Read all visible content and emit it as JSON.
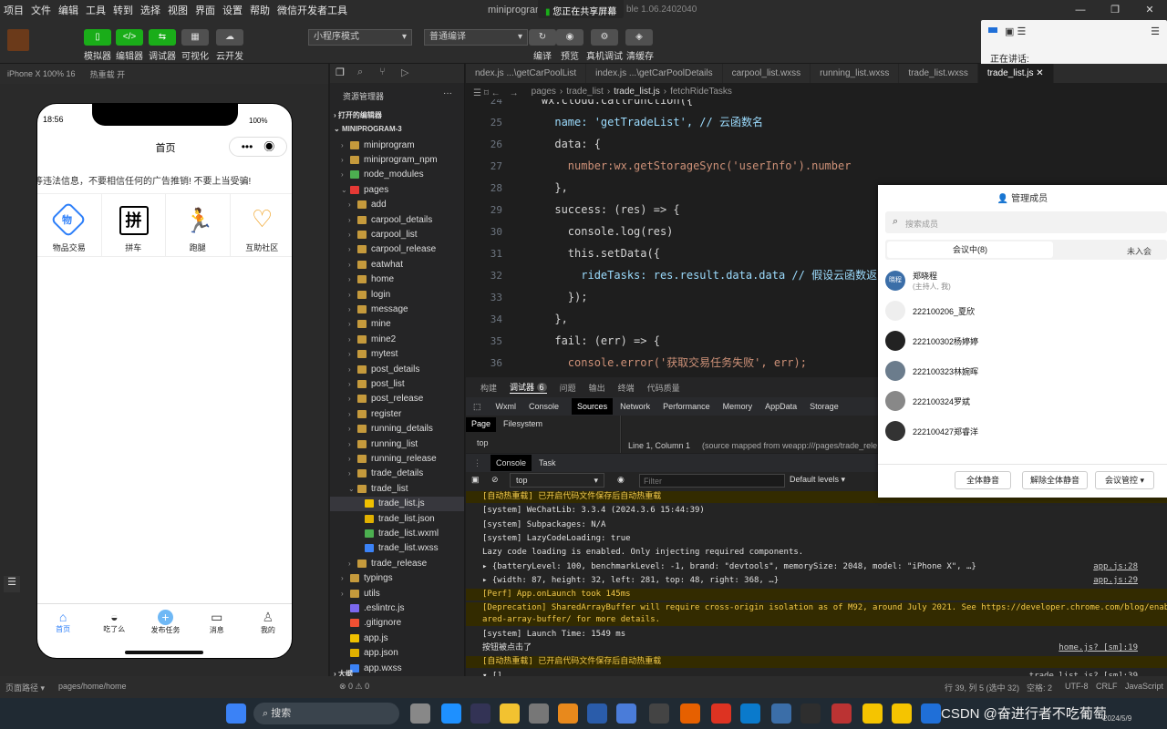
{
  "menubar": {
    "items": [
      "项目",
      "文件",
      "编辑",
      "工具",
      "转到",
      "选择",
      "视图",
      "界面",
      "设置",
      "帮助",
      "微信开发者工具"
    ],
    "title_left": "miniprogram",
    "title_right": "ble 1.06.2402040"
  },
  "share_banner": "您正在共享屏幕",
  "speaking": {
    "label": "正在讲话:"
  },
  "toolbar": {
    "buttons": [
      "模拟器",
      "编辑器",
      "调试器",
      "可视化",
      "云开发"
    ],
    "mode_select": "小程序模式",
    "compile_select": "普通编译",
    "right_buttons": [
      "编译",
      "预览",
      "真机调试",
      "清缓存"
    ]
  },
  "simulator": {
    "device": "iPhone X 100% 16",
    "hot_reload": "热重载 开",
    "status_time": "18:56",
    "battery": "100%",
    "nav_title": "首页",
    "marquee": "等违法信息，不要相信任何的广告推销! 不要上当受骗!",
    "grid": [
      "物品交易",
      "拼车",
      "跑腿",
      "互助社区"
    ],
    "grid_icon_text": [
      "物",
      "拼"
    ],
    "tabbar": [
      "首页",
      "吃了么",
      "发布任务",
      "消息",
      "我的"
    ]
  },
  "explorer": {
    "title": "资源管理器",
    "open_editors": "打开的编辑器",
    "project": "MINIPROGRAM-3",
    "items": [
      {
        "name": "miniprogram",
        "type": "folder",
        "indent": 1
      },
      {
        "name": "miniprogram_npm",
        "type": "folder",
        "indent": 1
      },
      {
        "name": "node_modules",
        "type": "folder-green",
        "indent": 1
      },
      {
        "name": "pages",
        "type": "folder-red",
        "indent": 1
      },
      {
        "name": "add",
        "type": "folder",
        "indent": 2
      },
      {
        "name": "carpool_details",
        "type": "folder",
        "indent": 2
      },
      {
        "name": "carpool_list",
        "type": "folder",
        "indent": 2
      },
      {
        "name": "carpool_release",
        "type": "folder",
        "indent": 2
      },
      {
        "name": "eatwhat",
        "type": "folder",
        "indent": 2
      },
      {
        "name": "home",
        "type": "folder",
        "indent": 2
      },
      {
        "name": "login",
        "type": "folder",
        "indent": 2
      },
      {
        "name": "message",
        "type": "folder",
        "indent": 2
      },
      {
        "name": "mine",
        "type": "folder",
        "indent": 2
      },
      {
        "name": "mine2",
        "type": "folder",
        "indent": 2
      },
      {
        "name": "mytest",
        "type": "folder",
        "indent": 2
      },
      {
        "name": "post_details",
        "type": "folder",
        "indent": 2
      },
      {
        "name": "post_list",
        "type": "folder",
        "indent": 2
      },
      {
        "name": "post_release",
        "type": "folder",
        "indent": 2
      },
      {
        "name": "register",
        "type": "folder",
        "indent": 2
      },
      {
        "name": "running_details",
        "type": "folder",
        "indent": 2
      },
      {
        "name": "running_list",
        "type": "folder",
        "indent": 2
      },
      {
        "name": "running_release",
        "type": "folder",
        "indent": 2
      },
      {
        "name": "trade_details",
        "type": "folder",
        "indent": 2
      },
      {
        "name": "trade_list",
        "type": "folder",
        "indent": 2
      },
      {
        "name": "trade_list.js",
        "type": "js",
        "indent": 3
      },
      {
        "name": "trade_list.json",
        "type": "json",
        "indent": 3
      },
      {
        "name": "trade_list.wxml",
        "type": "wxml",
        "indent": 3
      },
      {
        "name": "trade_list.wxss",
        "type": "wxss",
        "indent": 3
      },
      {
        "name": "trade_release",
        "type": "folder",
        "indent": 2
      },
      {
        "name": "typings",
        "type": "folder",
        "indent": 1
      },
      {
        "name": "utils",
        "type": "folder",
        "indent": 1
      },
      {
        "name": ".eslintrc.js",
        "type": "eslint",
        "indent": 1
      },
      {
        "name": ".gitignore",
        "type": "git",
        "indent": 1
      },
      {
        "name": "app.js",
        "type": "js",
        "indent": 1
      },
      {
        "name": "app.json",
        "type": "json",
        "indent": 1
      },
      {
        "name": "app.wxss",
        "type": "wxss",
        "indent": 1
      }
    ],
    "outline": "大纲",
    "problems": "⊗ 0 ⚠ 0"
  },
  "tabs": [
    "ndex.js ...\\getCarPoolList",
    "index.js ...\\getCarPoolDetails",
    "carpool_list.wxss",
    "running_list.wxss",
    "trade_list.wxss",
    "trade_list.js"
  ],
  "breadcrumb": [
    "pages",
    "trade_list",
    "trade_list.js",
    "fetchRideTasks"
  ],
  "code": [
    {
      "n": "24",
      "t": "    wx.cloud.callFunction({"
    },
    {
      "n": "25",
      "t": "      name: 'getTradeList', // 云函数名"
    },
    {
      "n": "26",
      "t": "      data: {"
    },
    {
      "n": "27",
      "t": "        number:wx.getStorageSync('userInfo').number"
    },
    {
      "n": "28",
      "t": "      },"
    },
    {
      "n": "29",
      "t": "      success: (res) => {"
    },
    {
      "n": "30",
      "t": "        console.log(res)"
    },
    {
      "n": "31",
      "t": "        this.setData({"
    },
    {
      "n": "32",
      "t": "          rideTasks: res.result.data.data // 假设云函数返回的任务"
    },
    {
      "n": "33",
      "t": "        });"
    },
    {
      "n": "34",
      "t": "      },"
    },
    {
      "n": "35",
      "t": "      fail: (err) => {"
    },
    {
      "n": "36",
      "t": "        console.error('获取交易任务失败', err);"
    }
  ],
  "panel_tabs": [
    "构建",
    "调试器",
    "问题",
    "输出",
    "终端",
    "代码质量"
  ],
  "debugger_badge": "6",
  "devtools_tabs": [
    "Wxml",
    "Console",
    "Sources",
    "Network",
    "Performance",
    "Memory",
    "AppData",
    "Storage"
  ],
  "sources": {
    "tabs": [
      "Page",
      "Filesystem"
    ],
    "tree_top": "top",
    "position": "Line 1, Column 1",
    "mapped": "(source mapped from weapp:///pages/trade_rele"
  },
  "console": {
    "tabs": [
      "Console",
      "Task"
    ],
    "context": "top",
    "filter_placeholder": "Filter",
    "levels": "Default levels",
    "lines": [
      {
        "t": "[自动热重载] 已开启代码文件保存后自动热重载",
        "w": true,
        "s": ""
      },
      {
        "t": "[system] WeChatLib: 3.3.4 (2024.3.6 15:44:39)",
        "w": false,
        "s": ""
      },
      {
        "t": "[system] Subpackages: N/A",
        "w": false,
        "s": ""
      },
      {
        "t": "[system] LazyCodeLoading: true",
        "w": false,
        "s": ""
      },
      {
        "t": "Lazy code loading is enabled. Only injecting required components.",
        "w": false,
        "s": ""
      },
      {
        "t": "▸ {batteryLevel: 100, benchmarkLevel: -1, brand: \"devtools\", memorySize: 2048, model: \"iPhone X\", …}",
        "w": false,
        "s": "app.js:28"
      },
      {
        "t": "▸ {width: 87, height: 32, left: 281, top: 48, right: 368, …}",
        "w": false,
        "s": "app.js:29"
      },
      {
        "t": "[Perf] App.onLaunch took 145ms",
        "w": true,
        "s": ""
      },
      {
        "t": "[Deprecation] SharedArrayBuffer will require cross-origin isolation as of M92, around July 2021. See https://developer.chrome.com/blog/enabling-sh\nared-array-buffer/ for more details.",
        "w": true,
        "s": ""
      },
      {
        "t": "[system] Launch Time: 1549 ms",
        "w": false,
        "s": ""
      },
      {
        "t": "按钮被点击了",
        "w": false,
        "s": "home.js? [sm]:19"
      },
      {
        "t": "[自动热重载] 已开启代码文件保存后自动热重载",
        "w": true,
        "s": ""
      },
      {
        "t": "▾ []",
        "w": false,
        "s": "trade_list.js? [sm]:39"
      }
    ]
  },
  "members": {
    "title": "管理成员",
    "search_placeholder": "搜索成员",
    "tab_in": "会议中(8)",
    "tab_out": "未入会",
    "list": [
      {
        "name": "郑晓程",
        "sub": "(主持人, 我)",
        "avatar": "郑晓程"
      },
      {
        "name": "222100206_夏欣",
        "sub": "",
        "avatar": ""
      },
      {
        "name": "222100302杨婷婷",
        "sub": "",
        "avatar": ""
      },
      {
        "name": "222100323林婉晖",
        "sub": "",
        "avatar": ""
      },
      {
        "name": "222100324罗斌",
        "sub": "",
        "avatar": ""
      },
      {
        "name": "222100427郑睿洋",
        "sub": "",
        "avatar": ""
      }
    ],
    "buttons": [
      "全体静音",
      "解除全体静音",
      "会议管控 ▾"
    ]
  },
  "statusbar": {
    "left_path": "页面路径 ▾",
    "page": "pages/home/home",
    "cursor": "行 39, 列 5 (选中 32)",
    "spaces": "空格: 2",
    "encoding": "UTF-8",
    "eol": "CRLF",
    "lang": "JavaScript"
  },
  "taskbar": {
    "search": "搜索",
    "watermark": "CSDN @奋进行者不吃葡萄",
    "date": "2024/5/9"
  }
}
